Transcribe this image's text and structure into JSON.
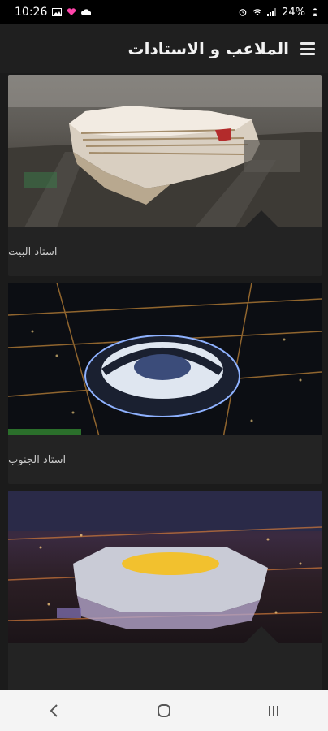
{
  "status_bar": {
    "time": "10:26",
    "battery": "24%",
    "left_icons": [
      "image-icon",
      "heart-icon",
      "cloud-icon"
    ],
    "right_icons": [
      "alarm-icon",
      "wifi-icon",
      "signal-icon",
      "battery-icon"
    ]
  },
  "header": {
    "title": "الملاعب و الاستادات",
    "menu_icon": "hamburger-menu-icon"
  },
  "stadiums": [
    {
      "label": "استاد البيت"
    },
    {
      "label": "استاد الجنوب"
    },
    {
      "label": ""
    }
  ],
  "nav": {
    "back_icon": "back-chevron-icon",
    "home_icon": "home-circle-icon",
    "recents_icon": "recents-icon"
  },
  "colors": {
    "background": "#1b1b1b",
    "card": "#232323",
    "status_bar": "#000000",
    "nav_bar": "#f4f4f4"
  }
}
